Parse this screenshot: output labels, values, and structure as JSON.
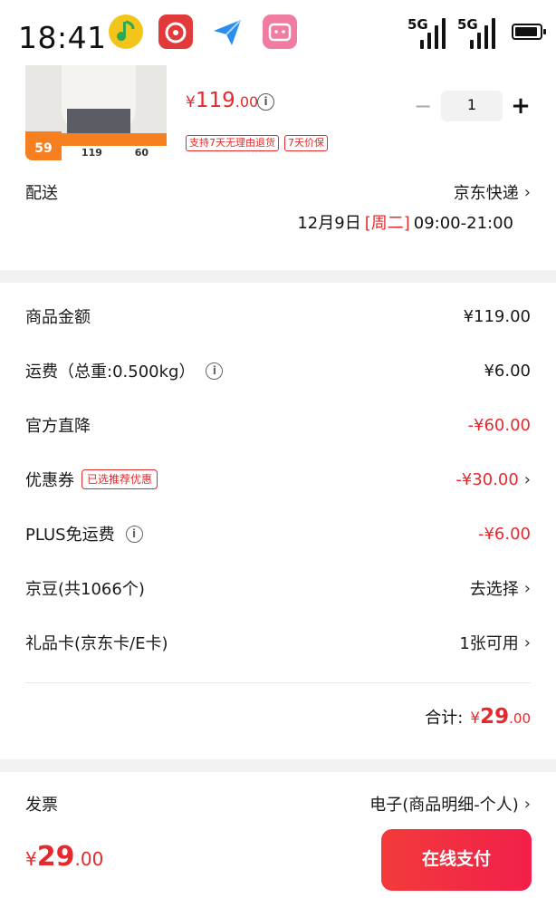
{
  "status_bar": {
    "time": "18:41",
    "signal_1": "5G",
    "signal_2": "5G",
    "apps": [
      "qq-music-icon",
      "netease-music-icon",
      "paper-plane-icon",
      "bilibili-icon"
    ]
  },
  "product": {
    "thumb_badge": "59",
    "thumb_price_a": "119",
    "thumb_price_b": "60",
    "price_symbol": "¥",
    "price_int": "119",
    "price_dec": ".00",
    "tags": [
      "支持7天无理由退货",
      "7天价保"
    ],
    "quantity": "1"
  },
  "delivery": {
    "label": "配送",
    "carrier": "京东快递",
    "date": "12月9日",
    "weekday": "[周二]",
    "time_window": "09:00-21:00"
  },
  "summary": {
    "goods_amount_label": "商品金额",
    "goods_amount": "¥119.00",
    "shipping_label": "运费（总重:0.500kg）",
    "shipping_value": "¥6.00",
    "direct_discount_label": "官方直降",
    "direct_discount_value": "-¥60.00",
    "coupon_label": "优惠券",
    "coupon_tag": "已选推荐优惠",
    "coupon_value": "-¥30.00",
    "plus_label": "PLUS免运费",
    "plus_value": "-¥6.00",
    "jingdou_label": "京豆(共1066个)",
    "jingdou_value": "去选择",
    "giftcard_label": "礼品卡(京东卡/E卡)",
    "giftcard_value": "1张可用",
    "total_label": "合计:",
    "total_symbol": "¥",
    "total_int": "29",
    "total_dec": ".00"
  },
  "invoice": {
    "label": "发票",
    "value": "电子(商品明细-个人)"
  },
  "footer": {
    "pay_symbol": "¥",
    "pay_int": "29",
    "pay_dec": ".00",
    "pay_button": "在线支付"
  },
  "colors": {
    "accent": "#e5292d",
    "pay_button": "#f2304a"
  }
}
